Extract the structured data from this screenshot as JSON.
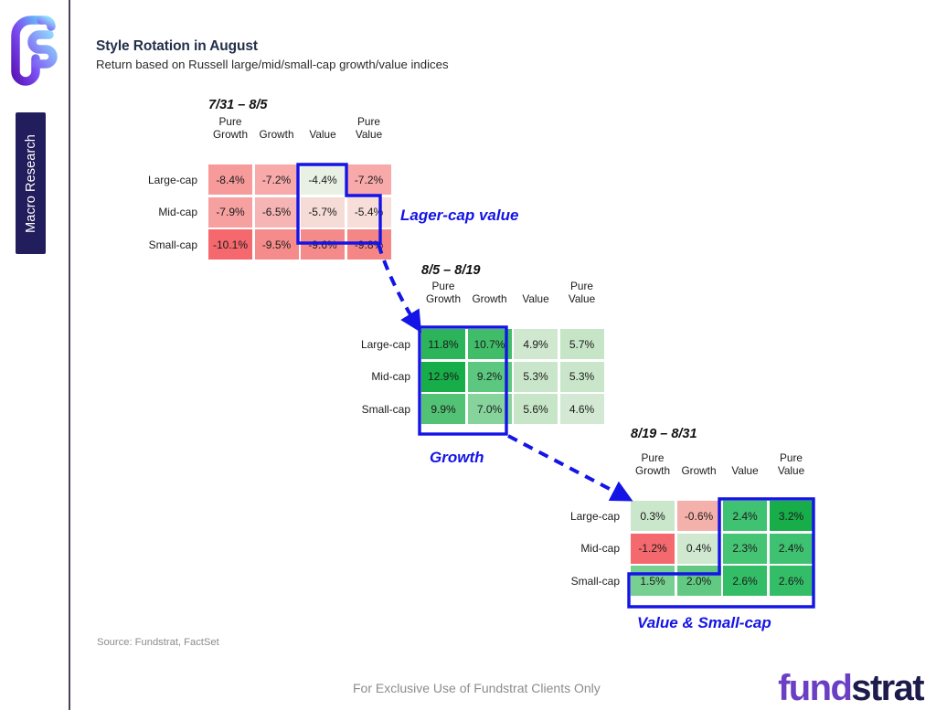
{
  "brand": {
    "logo_icon": "fundstrat-fs-monogram-icon",
    "rail_tab_label": "Macro Research",
    "wordmark_part1": "fund",
    "wordmark_part2": "strat",
    "wordmark_color1": "#6b3fc4",
    "wordmark_color2": "#1d1b4b",
    "rail_tab_color": "#221d5c"
  },
  "header": {
    "title": "Style Rotation in August",
    "subtitle": "Return based on Russell large/mid/small-cap growth/value indices"
  },
  "footer": {
    "source": "Source: Fundstrat, FactSet",
    "disclaimer": "For Exclusive Use of Fundstrat Clients Only"
  },
  "callout_color": "#1414e6",
  "panels": [
    {
      "id": "panel-7-31-8-5",
      "title": "7/31 – 8/5",
      "columns": [
        "Pure\nGrowth",
        "Growth",
        "Value",
        "Pure\nValue"
      ],
      "rows": [
        "Large-cap",
        "Mid-cap",
        "Small-cap"
      ],
      "values": [
        [
          "-8.4%",
          "-7.2%",
          "-4.4%",
          "-7.2%"
        ],
        [
          "-7.9%",
          "-6.5%",
          "-5.7%",
          "-5.4%"
        ],
        [
          "-10.1%",
          "-9.5%",
          "-9.6%",
          "-9.8%"
        ]
      ],
      "colors": [
        [
          "#f79a9a",
          "#f8a9a9",
          "#e8f1e4",
          "#f8a9a9"
        ],
        [
          "#f7a0a0",
          "#f7b4b4",
          "#f6dcd6",
          "#f7ded8"
        ],
        [
          "#f4686e",
          "#f58b8b",
          "#f58a8a",
          "#f58686"
        ]
      ],
      "callout": "Lager-cap value"
    },
    {
      "id": "panel-8-5-8-19",
      "title": "8/5 – 8/19",
      "columns": [
        "Pure\nGrowth",
        "Growth",
        "Value",
        "Pure\nValue"
      ],
      "rows": [
        "Large-cap",
        "Mid-cap",
        "Small-cap"
      ],
      "values": [
        [
          "11.8%",
          "10.7%",
          "4.9%",
          "5.7%"
        ],
        [
          "12.9%",
          "9.2%",
          "5.3%",
          "5.3%"
        ],
        [
          "9.9%",
          "7.0%",
          "5.6%",
          "4.6%"
        ]
      ],
      "colors": [
        [
          "#2cb45a",
          "#41bd69",
          "#cfe8cf",
          "#c6e4c6"
        ],
        [
          "#17ad49",
          "#5cc77e",
          "#cae6ca",
          "#cae6ca"
        ],
        [
          "#52c375",
          "#86d49c",
          "#c7e5c7",
          "#d3e9d3"
        ]
      ],
      "callout": "Growth"
    },
    {
      "id": "panel-8-19-8-31",
      "title": "8/19 – 8/31",
      "columns": [
        "Pure\nGrowth",
        "Growth",
        "Value",
        "Pure\nValue"
      ],
      "rows": [
        "Large-cap",
        "Mid-cap",
        "Small-cap"
      ],
      "values": [
        [
          "0.3%",
          "-0.6%",
          "2.4%",
          "3.2%"
        ],
        [
          "-1.2%",
          "0.4%",
          "2.3%",
          "2.4%"
        ],
        [
          "1.5%",
          "2.0%",
          "2.6%",
          "2.6%"
        ]
      ],
      "colors": [
        [
          "#cbe7cb",
          "#f4b1ab",
          "#3fc271",
          "#17ad49"
        ],
        [
          "#f4696e",
          "#cfe8cf",
          "#45c474",
          "#3ec170"
        ],
        [
          "#78cf92",
          "#62c982",
          "#33bd66",
          "#33bd66"
        ]
      ],
      "callout": "Value & Small-cap"
    }
  ],
  "arrows": [
    {
      "name": "arrow-panel1-to-panel2"
    },
    {
      "name": "arrow-panel2-to-panel3"
    }
  ]
}
